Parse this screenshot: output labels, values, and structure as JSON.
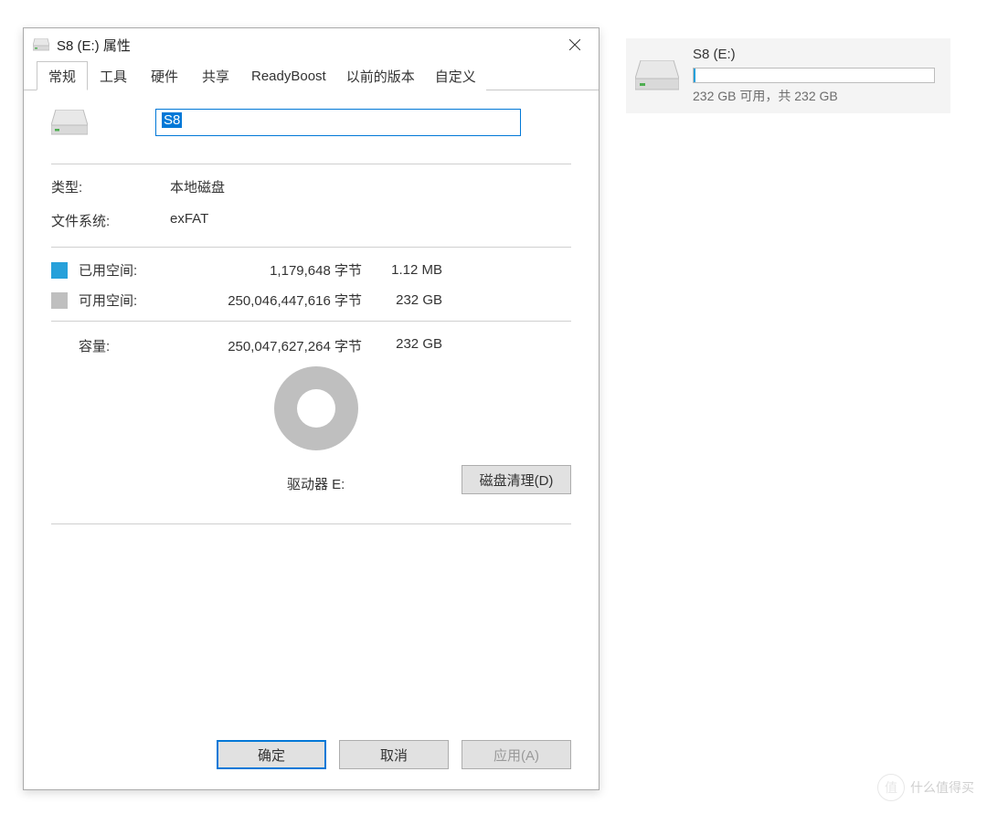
{
  "background_drive": {
    "title": "S8 (E:)",
    "subtitle": "232 GB 可用，共 232 GB"
  },
  "dialog": {
    "title": "S8 (E:) 属性",
    "drive_name": "S8",
    "tabs": [
      "常规",
      "工具",
      "硬件",
      "共享",
      "ReadyBoost",
      "以前的版本",
      "自定义"
    ],
    "active_tab": 0,
    "type_label": "类型:",
    "type_value": "本地磁盘",
    "fs_label": "文件系统:",
    "fs_value": "exFAT",
    "used_label": "已用空间:",
    "used_bytes": "1,179,648 字节",
    "used_unit": "1.12 MB",
    "free_label": "可用空间:",
    "free_bytes": "250,046,447,616 字节",
    "free_unit": "232 GB",
    "capacity_label": "容量:",
    "capacity_bytes": "250,047,627,264 字节",
    "capacity_unit": "232 GB",
    "drive_letter_label": "驱动器 E:",
    "disk_cleanup_button": "磁盘清理(D)"
  },
  "footer": {
    "ok": "确定",
    "cancel": "取消",
    "apply": "应用(A)"
  },
  "colors": {
    "used": "#26a0da",
    "free": "#bfbfbf",
    "accent": "#0078d7"
  },
  "watermark": "什么值得买",
  "chart_data": {
    "type": "pie",
    "title": "驱动器 E:",
    "series": [
      {
        "name": "已用空间",
        "bytes": 1179648,
        "display": "1.12 MB",
        "color": "#26a0da"
      },
      {
        "name": "可用空间",
        "bytes": 250046447616,
        "display": "232 GB",
        "color": "#bfbfbf"
      }
    ],
    "total": {
      "name": "容量",
      "bytes": 250047627264,
      "display": "232 GB"
    }
  }
}
